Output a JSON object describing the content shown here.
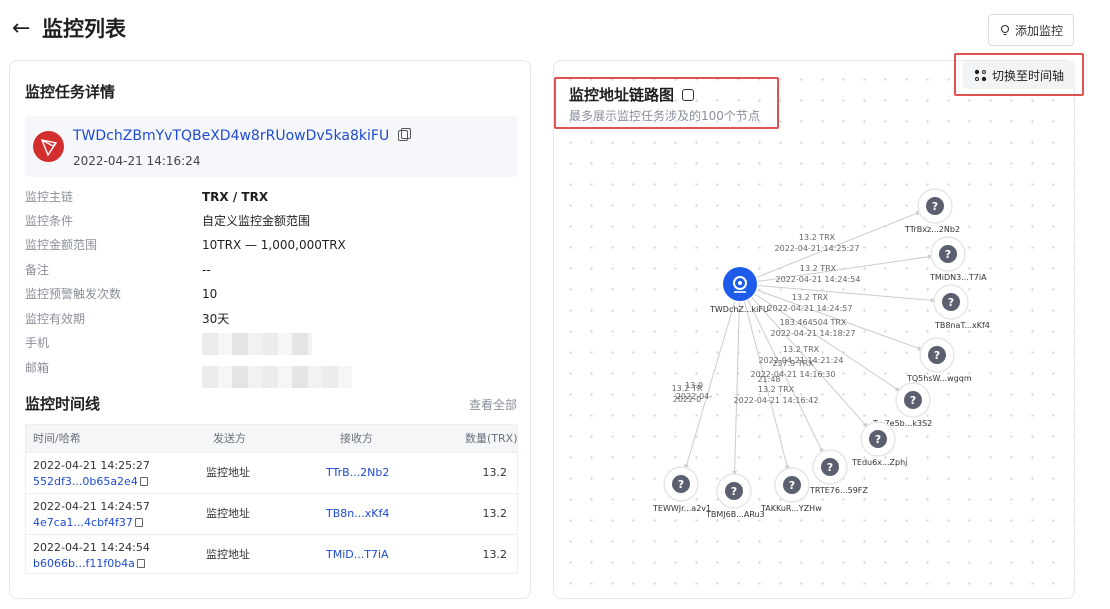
{
  "page": {
    "back_icon": "arrow-left-icon",
    "title": "监控列表",
    "add_button": "添加监控"
  },
  "details": {
    "title": "监控任务详情",
    "address": "TWDchZBmYvTQBeXD4w8rRUowDv5ka8kiFU",
    "created": "2022-04-21 14:16:24",
    "rows": [
      {
        "label": "监控主链",
        "value": "TRX / TRX"
      },
      {
        "label": "监控条件",
        "value": "自定义监控金额范围"
      },
      {
        "label": "监控金额范围",
        "value": "10TRX — 1,000,000TRX"
      },
      {
        "label": "备注",
        "value": "--"
      },
      {
        "label": "监控预警触发次数",
        "value": "10"
      },
      {
        "label": "监控有效期",
        "value": "30天"
      },
      {
        "label": "手机",
        "value": ""
      },
      {
        "label": "邮箱",
        "value": ""
      }
    ]
  },
  "timeline": {
    "title": "监控时间线",
    "view_all": "查看全部",
    "headers": [
      "时间/哈希",
      "发送方",
      "接收方",
      "数量(TRX)"
    ],
    "rows": [
      {
        "time": "2022-04-21 14:25:27",
        "hash": "552df3...0b65a2e4",
        "sender": "监控地址",
        "receiver": "TTrB...2Nb2",
        "amount": "13.2"
      },
      {
        "time": "2022-04-21 14:24:57",
        "hash": "4e7ca1...4cbf4f37",
        "sender": "监控地址",
        "receiver": "TB8n...xKf4",
        "amount": "13.2"
      },
      {
        "time": "2022-04-21 14:24:54",
        "hash": "b6066b...f11f0b4a",
        "sender": "监控地址",
        "receiver": "TMiD...T7iA",
        "amount": "13.2"
      }
    ]
  },
  "graph": {
    "title": "监控地址链路图",
    "subtitle": "最多展示监控任务涉及的100个节点",
    "timeline_button": "切换至时间轴",
    "center_label": "TWDchZ...kiFU",
    "nodes": [
      {
        "label": "TTrBxz...2Nb2"
      },
      {
        "label": "TMiDN3...T7iA"
      },
      {
        "label": "TB8naT...xKf4"
      },
      {
        "label": "TQ5hsW...wgqm"
      },
      {
        "label": "T...7e5b...k3S2"
      },
      {
        "label": "TEdu6x...Zphj"
      },
      {
        "label": "TRTE76...59FZ"
      },
      {
        "label": "TAKKuR...YZHw"
      },
      {
        "label": "TBMJ6B...ARu3"
      },
      {
        "label": "TEWWJr...a2v1"
      }
    ],
    "edge_labels": [
      {
        "amount": "13.2 TRX",
        "time": "2022-04-21 14:25:27"
      },
      {
        "amount": "13.2 TRX",
        "time": "2022-04-21 14:24:54"
      },
      {
        "amount": "13.2 TRX",
        "time": "2022-04-21 14:24:57"
      },
      {
        "amount": "183.464504 TRX",
        "time": "2022-04-21 14:18:27"
      },
      {
        "amount": "13.2 TRX",
        "time": "2022-04-21 14:21:24"
      },
      {
        "amount": "237.9 TRX",
        "time": "2022-04-21 14:16:30"
      },
      {
        "amount": "13.2 TRX",
        "time": "2022-04-21 14:16:42"
      },
      {
        "amount": "21:48",
        "time": ""
      },
      {
        "amount": "13.0",
        "time": "2022-04-"
      },
      {
        "amount": "13.2 TR",
        "time": "2022-0"
      }
    ],
    "colors": {
      "center": "#1e5bea",
      "node": "#5a6070",
      "edge": "#c9ccd2"
    }
  }
}
